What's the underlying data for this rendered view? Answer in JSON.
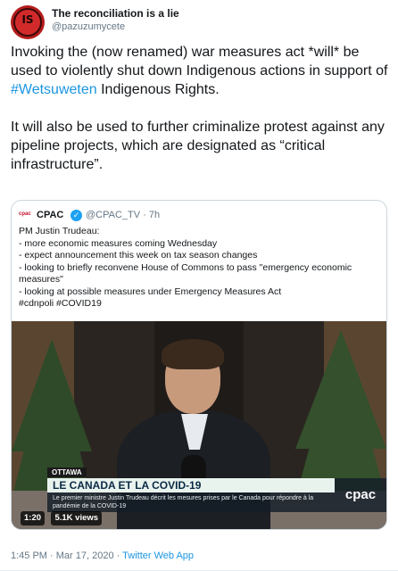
{
  "author": {
    "name": "The reconciliation is a lie",
    "handle": "@pazuzumycete",
    "avatar_mark": "IS"
  },
  "tweet": {
    "para1_before": "Invoking the (now renamed) war measures act *will* be used to violently shut down Indigenous actions in support of ",
    "hashtag": "#Wetsuweten",
    "para1_after": " Indigenous Rights.",
    "para2": "It will also be used to further criminalize protest against any pipeline projects, which are designated as “critical infrastructure”."
  },
  "quote": {
    "logo": "cpac",
    "name": "CPAC",
    "handle_time": "@CPAC_TV · 7h",
    "lines": [
      "PM Justin Trudeau:",
      "- more economic measures coming Wednesday",
      "- expect announcement this week on tax season changes",
      "- looking to briefly reconvene House of Commons to pass \"emergency economic measures\"",
      "- looking at possible measures under Emergency Measures Act",
      "#cdnpoli #COVID19"
    ],
    "video": {
      "location": "OTTAWA",
      "headline": "LE CANADA ET LA COVID-19",
      "subtitle": "Le premier ministre Justin Trudeau décrit les mesures prises par le Canada pour répondre à la pandémie de la COVID-19",
      "channel_logo": "cpac",
      "duration": "1:20",
      "views": "5.1K views"
    }
  },
  "footer": {
    "time_date": "1:45 PM · Mar 17, 2020 · ",
    "app": "Twitter Web App"
  },
  "colors": {
    "link": "#1b95e0",
    "verified": "#1da1f2",
    "muted": "#657786"
  }
}
